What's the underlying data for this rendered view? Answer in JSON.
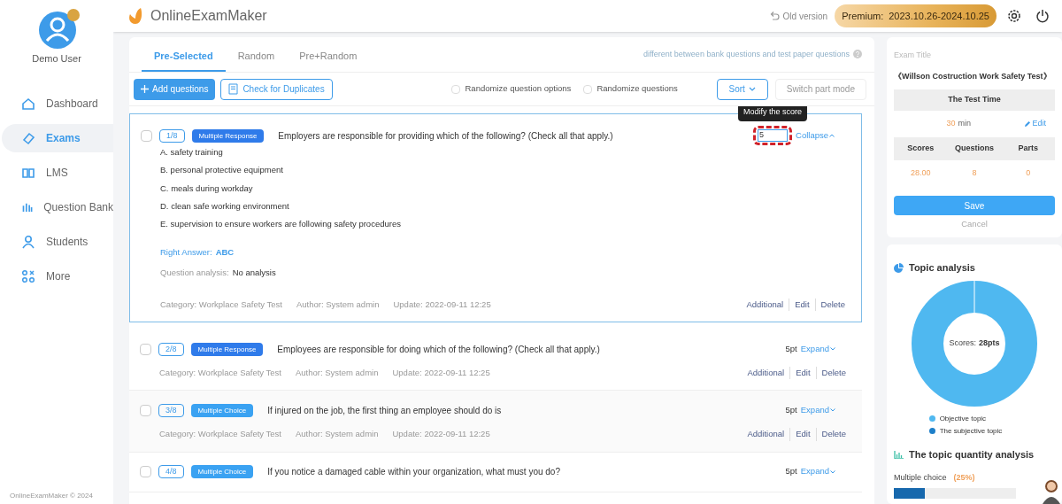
{
  "user": {
    "name": "Demo User"
  },
  "sidebar": {
    "items": [
      {
        "label": "Dashboard",
        "selected": false
      },
      {
        "label": "Exams",
        "selected": true
      },
      {
        "label": "LMS",
        "selected": false
      },
      {
        "label": "Question Bank",
        "selected": false
      },
      {
        "label": "Students",
        "selected": false
      },
      {
        "label": "More",
        "selected": false
      }
    ],
    "footer": "OnlineExamMaker © 2024"
  },
  "header": {
    "brand": "OnlineExamMaker",
    "old_version": "Old version",
    "premium_label": "Premium:",
    "premium_dates": "2023.10.26-2024.10.25"
  },
  "tabs": [
    {
      "label": "Pre-Selected",
      "selected": true
    },
    {
      "label": "Random",
      "selected": false
    },
    {
      "label": "Pre+Random",
      "selected": false
    }
  ],
  "hint_link": "different between bank questions and test paper questions",
  "toolbar": {
    "add": "Add questions",
    "duplicates": "Check for Duplicates",
    "options": [
      {
        "label": "Randomize question options",
        "checked": false
      },
      {
        "label": "Randomize questions",
        "checked": false
      }
    ],
    "sort": "Sort",
    "switch": "Switch part mode"
  },
  "questions": [
    {
      "number": "1/8",
      "kind": "response",
      "type": "Multiple Response",
      "text": "Employers are responsible for providing which of the following? (Check all that apply.)",
      "checked": false,
      "expanded": true,
      "score": "5",
      "editing": true,
      "tooltip": "Modify the score",
      "toggle": "Collapse",
      "options": [
        "A. safety training",
        "B. personal protective equipment",
        "C. meals during workday",
        "D. clean safe working environment",
        "E. supervision to ensure workers are following safety procedures"
      ],
      "answer_label": "Right Answer:",
      "answer": "ABC",
      "analysis_label": "Question analysis:",
      "analysis": "No analysis",
      "meta": [
        "Category: Workplace Safety Test",
        "Author: System admin",
        "Update: 2022-09-11 12:25"
      ],
      "actions": [
        "Additional",
        "Edit",
        "Delete"
      ]
    },
    {
      "number": "2/8",
      "kind": "response",
      "type": "Multiple Response",
      "text": "Employees are responsible for doing which of the following? (Check all that apply.)",
      "checked": false,
      "expanded": false,
      "score": "5pt",
      "editing": false,
      "toggle": "Expand",
      "meta": [
        "Category: Workplace Safety Test",
        "Author: System admin",
        "Update: 2022-09-11 12:25"
      ],
      "actions": [
        "Additional",
        "Edit",
        "Delete"
      ]
    },
    {
      "number": "3/8",
      "kind": "choice",
      "type": "Multiple Choice",
      "text": "If injured on the job, the first thing an employee should do is",
      "checked": false,
      "expanded": false,
      "score": "5pt",
      "editing": false,
      "toggle": "Expand",
      "meta": [
        "Category: Workplace Safety Test",
        "Author: System admin",
        "Update: 2022-09-11 12:25"
      ],
      "actions": [
        "Additional",
        "Edit",
        "Delete"
      ]
    },
    {
      "number": "4/8",
      "kind": "choice",
      "type": "Multiple Choice",
      "text": "If you notice a damaged cable within your organization, what must you do?",
      "checked": false,
      "expanded": false,
      "score": "5pt",
      "editing": false,
      "toggle": "Expand"
    }
  ],
  "exam": {
    "title_label": "Exam Title",
    "title": "《Willson Costruction Work Safety Test》",
    "time_header": "The Test Time",
    "time_value": "30",
    "time_unit": "min",
    "edit": "Edit",
    "stats": [
      {
        "label": "Scores",
        "value": "28.00"
      },
      {
        "label": "Questions",
        "value": "8"
      },
      {
        "label": "Parts",
        "value": "0"
      }
    ],
    "save": "Save",
    "cancel": "Cancel"
  },
  "topic_analysis": {
    "title": "Topic analysis",
    "center_label": "Scores:",
    "center_value": "28pts",
    "legend": [
      {
        "label": "Objective topic",
        "color": "#4fb8f0"
      },
      {
        "label": "The subjective topic",
        "color": "#1d7fc9"
      }
    ]
  },
  "quantity": {
    "title": "The topic quantity analysis",
    "items": [
      {
        "label": "Multiple choice",
        "percent": "(25%)",
        "level": 0.25
      }
    ]
  }
}
